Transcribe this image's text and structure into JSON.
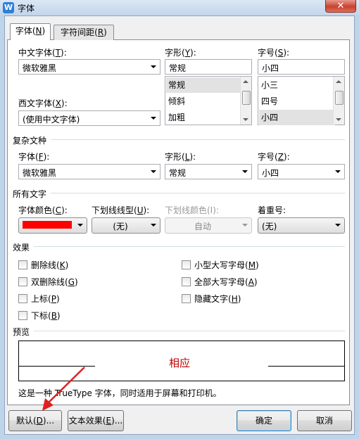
{
  "window": {
    "title": "字体",
    "app_icon": "W",
    "close_glyph": "✕"
  },
  "tabs": [
    {
      "label": "字体(",
      "key": "N",
      "tail": ")"
    },
    {
      "label": "字符间距(",
      "key": "R",
      "tail": ")"
    }
  ],
  "font_section": {
    "cn_font_label": "中文字体(",
    "cn_font_key": "T",
    "cn_font_tail": "):",
    "cn_font_value": "微软雅黑",
    "style_label": "字形(",
    "style_key": "Y",
    "style_tail": "):",
    "style_value": "常规",
    "style_options": [
      "常规",
      "倾斜",
      "加粗"
    ],
    "size_label": "字号(",
    "size_key": "S",
    "size_tail": "):",
    "size_value": "小四",
    "size_options": [
      "小三",
      "四号",
      "小四"
    ],
    "west_font_label": "西文字体(",
    "west_font_key": "X",
    "west_font_tail": "):",
    "west_font_value": "(使用中文字体)"
  },
  "complex_section": {
    "title": "复杂文种",
    "font_label": "字体(",
    "font_key": "F",
    "font_tail": "):",
    "font_value": "微软雅黑",
    "style_label": "字形(",
    "style_key": "L",
    "style_tail": "):",
    "style_value": "常规",
    "size_label": "字号(",
    "size_key": "Z",
    "size_tail": "):",
    "size_value": "小四"
  },
  "all_text_section": {
    "title": "所有文字",
    "color_label": "字体颜色(",
    "color_key": "C",
    "color_tail": "):",
    "color_value": "#ff0000",
    "underline_type_label": "下划线线型(",
    "underline_type_key": "U",
    "underline_type_tail": "):",
    "underline_type_value": "(无)",
    "underline_color_label": "下划线颜色(I):",
    "underline_color_value": "自动",
    "emphasis_label": "着重号:",
    "emphasis_value": "(无)"
  },
  "effects_section": {
    "title": "效果",
    "items": [
      {
        "label": "删除线(",
        "key": "K",
        "tail": ")"
      },
      {
        "label": "双删除线(",
        "key": "G",
        "tail": ")"
      },
      {
        "label": "上标(",
        "key": "P",
        "tail": ")"
      },
      {
        "label": "下标(",
        "key": "B",
        "tail": ")"
      },
      {
        "label": "小型大写字母(",
        "key": "M",
        "tail": ")"
      },
      {
        "label": "全部大写字母(",
        "key": "A",
        "tail": ")"
      },
      {
        "label": "隐藏文字(",
        "key": "H",
        "tail": ")"
      }
    ]
  },
  "preview": {
    "title": "预览",
    "sample_text": "相应",
    "sample_color": "#c00000",
    "description": "这是一种 TrueType 字体，同时适用于屏幕和打印机。"
  },
  "buttons": {
    "default_label": "默认(",
    "default_key": "D",
    "default_tail": ")...",
    "text_effect_label": "文本效果(",
    "text_effect_key": "E",
    "text_effect_tail": ")...",
    "ok_label": "确定",
    "cancel_label": "取消"
  },
  "annotation": {
    "arrow_color": "#e02020"
  }
}
